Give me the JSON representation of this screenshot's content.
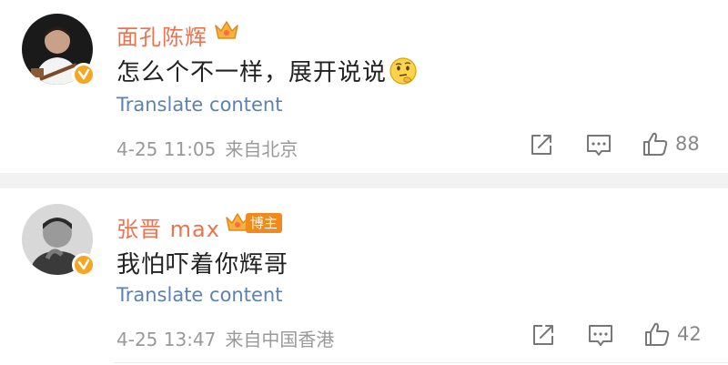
{
  "comments": [
    {
      "username": "面孔陈辉",
      "text": "怎么个不一样，展开说说",
      "translate_label": "Translate content",
      "time": "4-25 11:05",
      "location": "来自北京",
      "likes": "88",
      "avatar_icon": "avatar-photo",
      "emoji": "thinking-face-icon"
    },
    {
      "username": "张晋 max",
      "host_tag": "博主",
      "text": "我怕吓着你辉哥",
      "translate_label": "Translate content",
      "time": "4-25 13:47",
      "location": "来自中国香港",
      "likes": "42",
      "avatar_icon": "avatar-photo"
    }
  ],
  "colors": {
    "username": "#eb7350",
    "translate": "#5b82b2",
    "meta": "#999999",
    "verified_badge": "#f5a623",
    "host_tag": "#f08a1c"
  }
}
